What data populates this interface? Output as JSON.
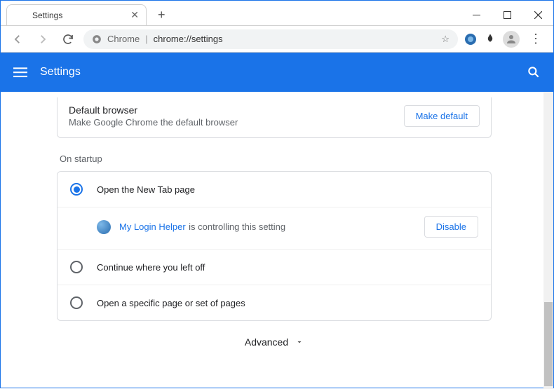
{
  "window": {
    "tab_title": "Settings"
  },
  "omnibox": {
    "label": "Chrome",
    "url": "chrome://settings"
  },
  "header": {
    "title": "Settings"
  },
  "default_browser": {
    "title": "Default browser",
    "subtitle": "Make Google Chrome the default browser",
    "button": "Make default"
  },
  "startup": {
    "section_label": "On startup",
    "options": [
      "Open the New Tab page",
      "Continue where you left off",
      "Open a specific page or set of pages"
    ],
    "controlled": {
      "ext_name": "My Login Helper",
      "msg": "is controlling this setting",
      "disable": "Disable"
    }
  },
  "advanced": "Advanced"
}
